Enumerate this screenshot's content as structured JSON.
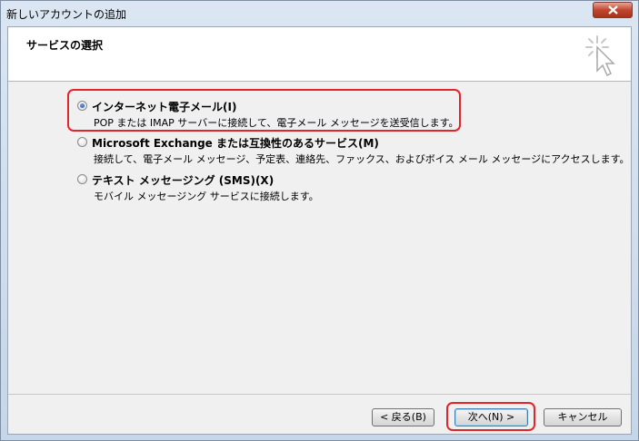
{
  "window": {
    "title": "新しいアカウントの追加",
    "close_label": "×"
  },
  "header": {
    "title": "サービスの選択",
    "icon": "wizard-cursor-icon"
  },
  "options": [
    {
      "label": "インターネット電子メール(I)",
      "description": "POP または IMAP サーバーに接続して、電子メール メッセージを送受信します。",
      "selected": true,
      "highlighted": true
    },
    {
      "label": "Microsoft Exchange または互換性のあるサービス(M)",
      "description": "接続して、電子メール メッセージ、予定表、連絡先、ファックス、およびボイス メール メッセージにアクセスします。",
      "selected": false,
      "highlighted": false
    },
    {
      "label": "テキスト メッセージング (SMS)(X)",
      "description": "モバイル メッセージング サービスに接続します。",
      "selected": false,
      "highlighted": false
    }
  ],
  "buttons": {
    "back": "< 戻る(B)",
    "next": "次へ(N) >",
    "cancel": "キャンセル"
  },
  "colors": {
    "highlight": "#e0262a",
    "client_background": "#f0f0f0",
    "header_background": "#ffffff"
  }
}
